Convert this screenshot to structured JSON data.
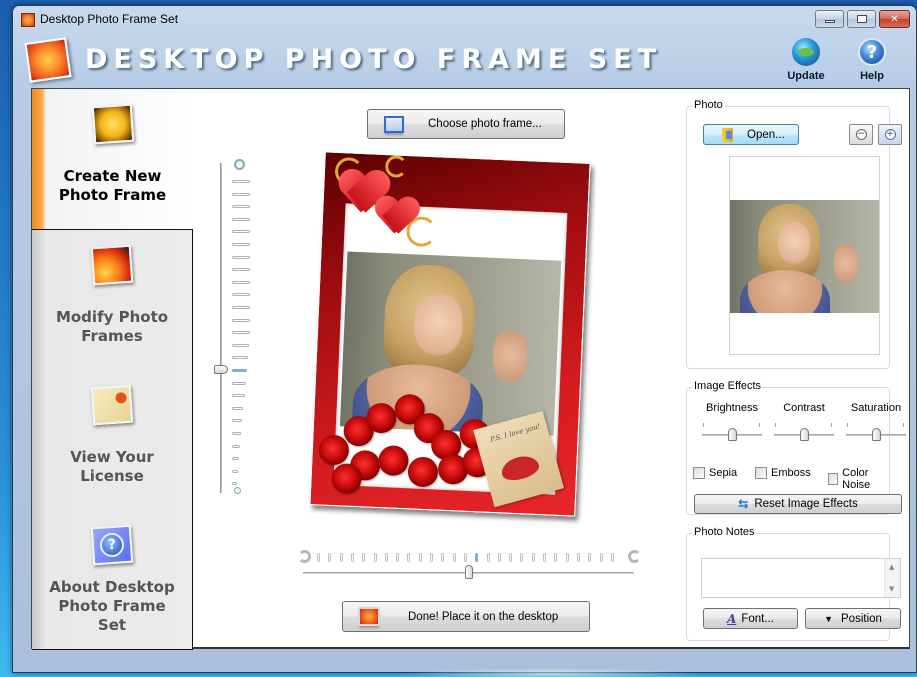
{
  "window": {
    "title": "Desktop Photo Frame Set",
    "controls": {
      "minimize": "minimize",
      "maximize": "maximize",
      "close": "✕"
    }
  },
  "header": {
    "logo_text": "DESKTOP PHOTO FRAME SET",
    "tools": [
      {
        "label": "Update",
        "icon": "update-globe-icon"
      },
      {
        "label": "Help",
        "icon": "help-icon",
        "glyph": "?"
      }
    ]
  },
  "sidebar": {
    "items": [
      {
        "label_line1": "Create New",
        "label_line2": "Photo Frame",
        "label_line3": "",
        "icon": "rose-photo-icon",
        "active": true
      },
      {
        "label_line1": "Modify Photo",
        "label_line2": "Frames",
        "label_line3": "",
        "icon": "photo-stack-icon",
        "active": false
      },
      {
        "label_line1": "View Your",
        "label_line2": "License",
        "label_line3": "",
        "icon": "certificate-icon",
        "active": false
      },
      {
        "label_line1": "About Desktop",
        "label_line2": "Photo Frame",
        "label_line3": "Set",
        "icon": "question-icon",
        "glyph": "?",
        "active": false
      }
    ]
  },
  "center": {
    "choose_frame_label": "Choose photo frame...",
    "zoom_slider": {
      "ticks": 25,
      "current_tick_from_top": 15
    },
    "envelope_note": "P.S. I love you!",
    "rotation_slider": {
      "ticks": 27,
      "current_tick": 14,
      "value_fraction": 0.5
    },
    "done_label": "Done! Place it on the desktop"
  },
  "photo_panel": {
    "title": "Photo",
    "open_label": "Open...",
    "zoom_out_glyph": "−",
    "zoom_in_glyph": "+"
  },
  "effects_panel": {
    "title": "Image Effects",
    "sliders": [
      {
        "label": "Brightness",
        "value_fraction": 0.5
      },
      {
        "label": "Contrast",
        "value_fraction": 0.5
      },
      {
        "label": "Saturation",
        "value_fraction": 0.5
      }
    ],
    "checkboxes": [
      {
        "label": "Sepia",
        "checked": false
      },
      {
        "label": "Emboss",
        "checked": false
      },
      {
        "label": "Color Noise",
        "checked": false
      }
    ],
    "reset_label": "Reset Image Effects",
    "reset_glyph": "⇆"
  },
  "notes_panel": {
    "title": "Photo Notes",
    "notes_value": "",
    "font_label": "Font...",
    "font_glyph": "A",
    "position_label": "Position",
    "position_glyph": "▼",
    "scroll_up": "▲",
    "scroll_down": "▼"
  }
}
